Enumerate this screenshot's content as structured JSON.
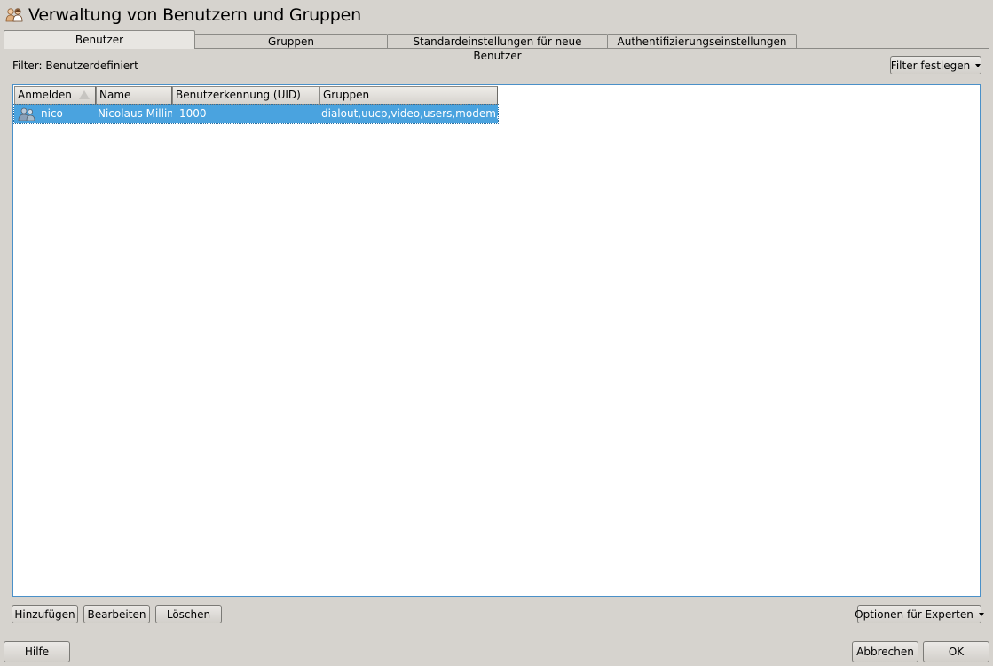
{
  "window": {
    "title": "Verwaltung von Benutzern und Gruppen"
  },
  "tabs": [
    {
      "label": "Benutzer",
      "active": true
    },
    {
      "label": "Gruppen",
      "active": false
    },
    {
      "label": "Standardeinstellungen für neue Benutzer",
      "active": false
    },
    {
      "label": "Authentifizierungseinstellungen",
      "active": false
    }
  ],
  "filter": {
    "label": "Filter: Benutzerdefiniert",
    "button_label": "Filter festlegen"
  },
  "table": {
    "columns": [
      "Anmelden",
      "Name",
      "Benutzerkennung (UID)",
      "Gruppen"
    ],
    "rows": [
      {
        "login": "nico",
        "name": "Nicolaus Millin",
        "uid": "1000",
        "groups": "dialout,uucp,video,users,modem,tty"
      }
    ]
  },
  "actions": {
    "add": "Hinzufügen",
    "edit": "Bearbeiten",
    "delete": "Löschen",
    "expert": "Optionen für Experten"
  },
  "footer": {
    "help": "Hilfe",
    "cancel": "Abbrechen",
    "ok": "OK"
  },
  "colors": {
    "background": "#d6d3ce",
    "selection": "#4aa3df",
    "frame_border": "#4a90c8"
  }
}
